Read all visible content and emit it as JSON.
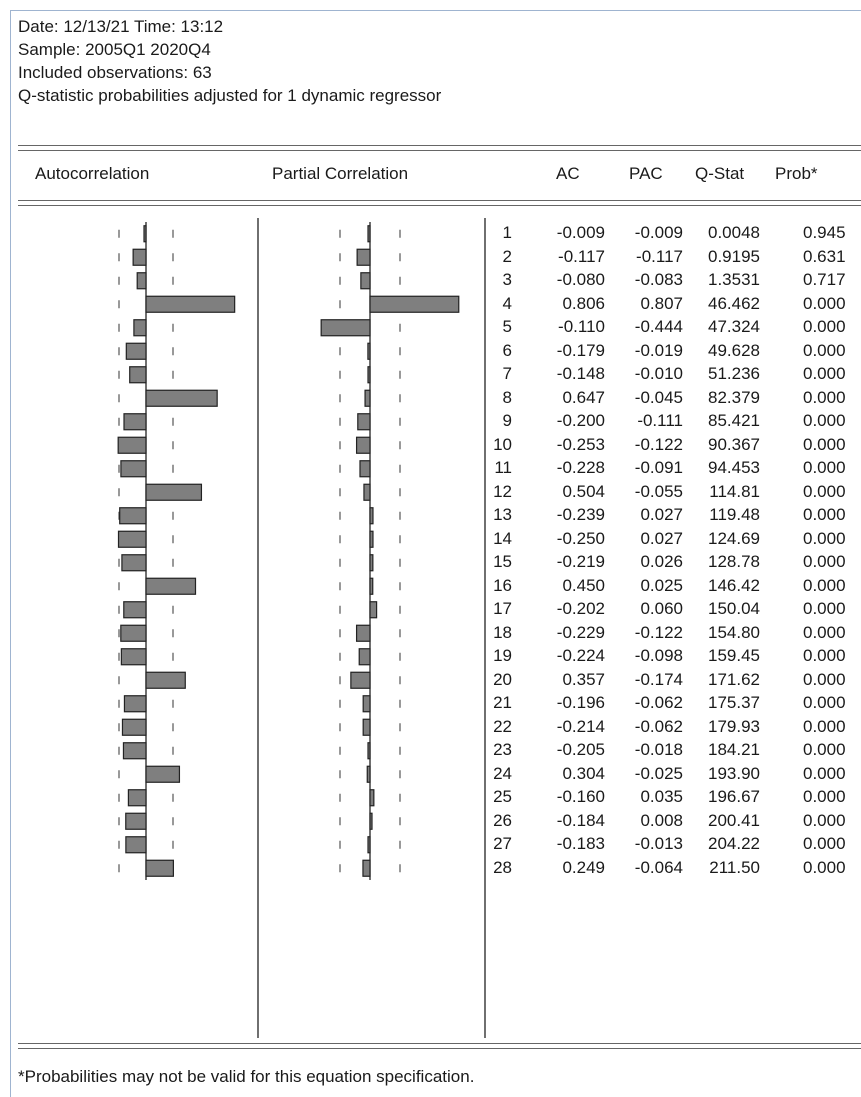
{
  "header": {
    "date_line": "Date: 12/13/21   Time: 13:12",
    "sample_line": "Sample: 2005Q1 2020Q4",
    "obs_line": "Included observations: 63",
    "note_line": "Q-statistic probabilities adjusted for 1 dynamic regressor"
  },
  "columns": {
    "autocorrelation": "Autocorrelation",
    "partial_correlation": "Partial Correlation",
    "ac": "AC",
    "pac": "PAC",
    "qstat": "Q-Stat",
    "prob": "Prob*"
  },
  "footnote": "*Probabilities may not be valid for this equation specification.",
  "chart_data": {
    "type": "table",
    "lags": [
      1,
      2,
      3,
      4,
      5,
      6,
      7,
      8,
      9,
      10,
      11,
      12,
      13,
      14,
      15,
      16,
      17,
      18,
      19,
      20,
      21,
      22,
      23,
      24,
      25,
      26,
      27,
      28
    ],
    "ac": [
      -0.009,
      -0.117,
      -0.08,
      0.806,
      -0.11,
      -0.179,
      -0.148,
      0.647,
      -0.2,
      -0.253,
      -0.228,
      0.504,
      -0.239,
      -0.25,
      -0.219,
      0.45,
      -0.202,
      -0.229,
      -0.224,
      0.357,
      -0.196,
      -0.214,
      -0.205,
      0.304,
      -0.16,
      -0.184,
      -0.183,
      0.249
    ],
    "pac": [
      -0.009,
      -0.117,
      -0.083,
      0.807,
      -0.444,
      -0.019,
      -0.01,
      -0.045,
      -0.111,
      -0.122,
      -0.091,
      -0.055,
      0.027,
      0.027,
      0.026,
      0.025,
      0.06,
      -0.122,
      -0.098,
      -0.174,
      -0.062,
      -0.062,
      -0.018,
      -0.025,
      0.035,
      0.008,
      -0.013,
      -0.064
    ],
    "rows": [
      {
        "lag": "1",
        "ac": "-0.009",
        "pac": "-0.009",
        "q": "0.0048",
        "p": "0.945"
      },
      {
        "lag": "2",
        "ac": "-0.117",
        "pac": "-0.117",
        "q": "0.9195",
        "p": "0.631"
      },
      {
        "lag": "3",
        "ac": "-0.080",
        "pac": "-0.083",
        "q": "1.3531",
        "p": "0.717"
      },
      {
        "lag": "4",
        "ac": "0.806",
        "pac": "0.807",
        "q": "46.462",
        "p": "0.000"
      },
      {
        "lag": "5",
        "ac": "-0.110",
        "pac": "-0.444",
        "q": "47.324",
        "p": "0.000"
      },
      {
        "lag": "6",
        "ac": "-0.179",
        "pac": "-0.019",
        "q": "49.628",
        "p": "0.000"
      },
      {
        "lag": "7",
        "ac": "-0.148",
        "pac": "-0.010",
        "q": "51.236",
        "p": "0.000"
      },
      {
        "lag": "8",
        "ac": "0.647",
        "pac": "-0.045",
        "q": "82.379",
        "p": "0.000"
      },
      {
        "lag": "9",
        "ac": "-0.200",
        "pac": "-0.111",
        "q": "85.421",
        "p": "0.000"
      },
      {
        "lag": "10",
        "ac": "-0.253",
        "pac": "-0.122",
        "q": "90.367",
        "p": "0.000"
      },
      {
        "lag": "11",
        "ac": "-0.228",
        "pac": "-0.091",
        "q": "94.453",
        "p": "0.000"
      },
      {
        "lag": "12",
        "ac": "0.504",
        "pac": "-0.055",
        "q": "114.81",
        "p": "0.000"
      },
      {
        "lag": "13",
        "ac": "-0.239",
        "pac": "0.027",
        "q": "119.48",
        "p": "0.000"
      },
      {
        "lag": "14",
        "ac": "-0.250",
        "pac": "0.027",
        "q": "124.69",
        "p": "0.000"
      },
      {
        "lag": "15",
        "ac": "-0.219",
        "pac": "0.026",
        "q": "128.78",
        "p": "0.000"
      },
      {
        "lag": "16",
        "ac": "0.450",
        "pac": "0.025",
        "q": "146.42",
        "p": "0.000"
      },
      {
        "lag": "17",
        "ac": "-0.202",
        "pac": "0.060",
        "q": "150.04",
        "p": "0.000"
      },
      {
        "lag": "18",
        "ac": "-0.229",
        "pac": "-0.122",
        "q": "154.80",
        "p": "0.000"
      },
      {
        "lag": "19",
        "ac": "-0.224",
        "pac": "-0.098",
        "q": "159.45",
        "p": "0.000"
      },
      {
        "lag": "20",
        "ac": "0.357",
        "pac": "-0.174",
        "q": "171.62",
        "p": "0.000"
      },
      {
        "lag": "21",
        "ac": "-0.196",
        "pac": "-0.062",
        "q": "175.37",
        "p": "0.000"
      },
      {
        "lag": "22",
        "ac": "-0.214",
        "pac": "-0.062",
        "q": "179.93",
        "p": "0.000"
      },
      {
        "lag": "23",
        "ac": "-0.205",
        "pac": "-0.018",
        "q": "184.21",
        "p": "0.000"
      },
      {
        "lag": "24",
        "ac": "0.304",
        "pac": "-0.025",
        "q": "193.90",
        "p": "0.000"
      },
      {
        "lag": "25",
        "ac": "-0.160",
        "pac": "0.035",
        "q": "196.67",
        "p": "0.000"
      },
      {
        "lag": "26",
        "ac": "-0.184",
        "pac": "0.008",
        "q": "200.41",
        "p": "0.000"
      },
      {
        "lag": "27",
        "ac": "-0.183",
        "pac": "-0.013",
        "q": "204.22",
        "p": "0.000"
      },
      {
        "lag": "28",
        "ac": "0.249",
        "pac": "-0.064",
        "q": "211.50",
        "p": "0.000"
      }
    ],
    "bar_color": "#7f7f7f"
  }
}
